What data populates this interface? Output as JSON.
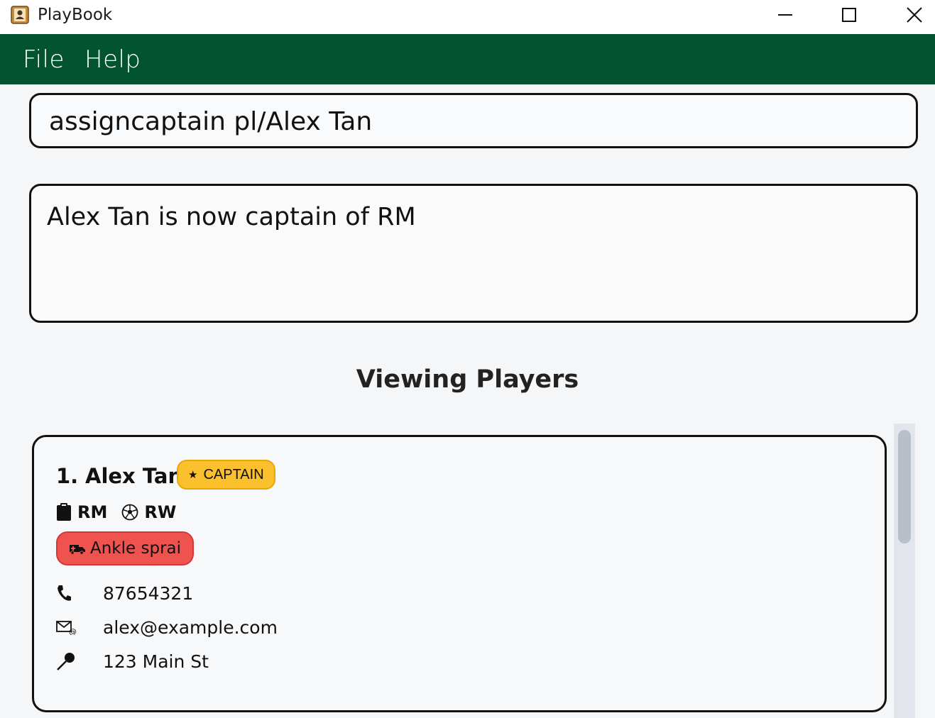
{
  "window": {
    "title": "PlayBook"
  },
  "menu": {
    "items": [
      "File",
      "Help"
    ]
  },
  "command": {
    "value": "assigncaptain pl/Alex Tan"
  },
  "result": {
    "message": "Alex Tan is now captain of RM"
  },
  "view": {
    "title": "Viewing Players"
  },
  "players": [
    {
      "index": "1.",
      "name": "Alex Tan",
      "captain_label": "CAPTAIN",
      "team": "RM",
      "position": "RW",
      "injury": "Ankle sprai",
      "phone": "87654321",
      "email": "alex@example.com",
      "address": "123 Main St"
    }
  ],
  "colors": {
    "menubar": "#025430",
    "captain_badge": "#fbc02d",
    "injury_badge": "#ef5350"
  }
}
